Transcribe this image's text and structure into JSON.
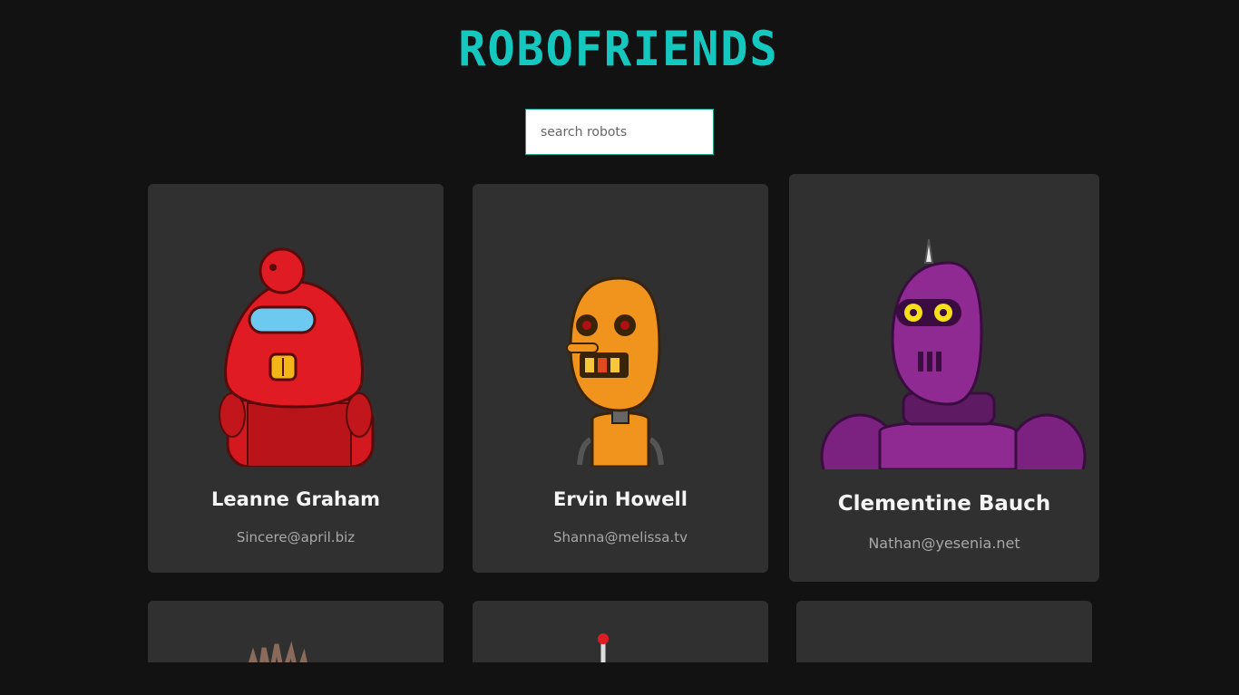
{
  "app": {
    "logo": "ROBOFRIENDS"
  },
  "search": {
    "placeholder": "search robots",
    "value": ""
  },
  "robots": [
    {
      "name": "Leanne Graham",
      "email": "Sincere@april.biz",
      "color": "#e01b24"
    },
    {
      "name": "Ervin Howell",
      "email": "Shanna@melissa.tv",
      "color": "#f0941e"
    },
    {
      "name": "Clementine Bauch",
      "email": "Nathan@yesenia.net",
      "color": "#8e2a92"
    }
  ],
  "colors": {
    "background": "#121212",
    "card": "#303030",
    "accent": "#14c8c0"
  }
}
